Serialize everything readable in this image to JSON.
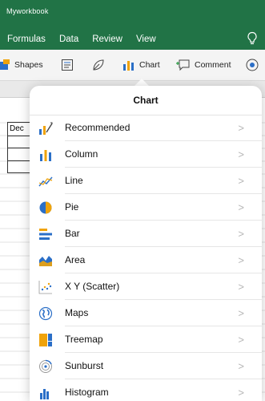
{
  "app": {
    "workbook_name": "Myworkbook",
    "tabs": [
      "Formulas",
      "Data",
      "Review",
      "View"
    ]
  },
  "toolbar": {
    "shapes_label": "Shapes",
    "chart_label": "Chart",
    "comment_label": "Comment"
  },
  "sheet": {
    "cell_text": "Dec"
  },
  "chart_menu": {
    "title": "Chart",
    "items": [
      {
        "label": "Recommended",
        "icon": "recommended-chart-icon"
      },
      {
        "label": "Column",
        "icon": "column-chart-icon"
      },
      {
        "label": "Line",
        "icon": "line-chart-icon"
      },
      {
        "label": "Pie",
        "icon": "pie-chart-icon"
      },
      {
        "label": "Bar",
        "icon": "bar-chart-icon"
      },
      {
        "label": "Area",
        "icon": "area-chart-icon"
      },
      {
        "label": "X Y (Scatter)",
        "icon": "scatter-chart-icon"
      },
      {
        "label": "Maps",
        "icon": "map-chart-icon"
      },
      {
        "label": "Treemap",
        "icon": "treemap-chart-icon"
      },
      {
        "label": "Sunburst",
        "icon": "sunburst-chart-icon"
      },
      {
        "label": "Histogram",
        "icon": "histogram-chart-icon"
      }
    ],
    "chevron": ">"
  },
  "colors": {
    "ribbon_green": "#217346",
    "icon_blue": "#2b6fc7",
    "icon_orange": "#f0a30a"
  }
}
